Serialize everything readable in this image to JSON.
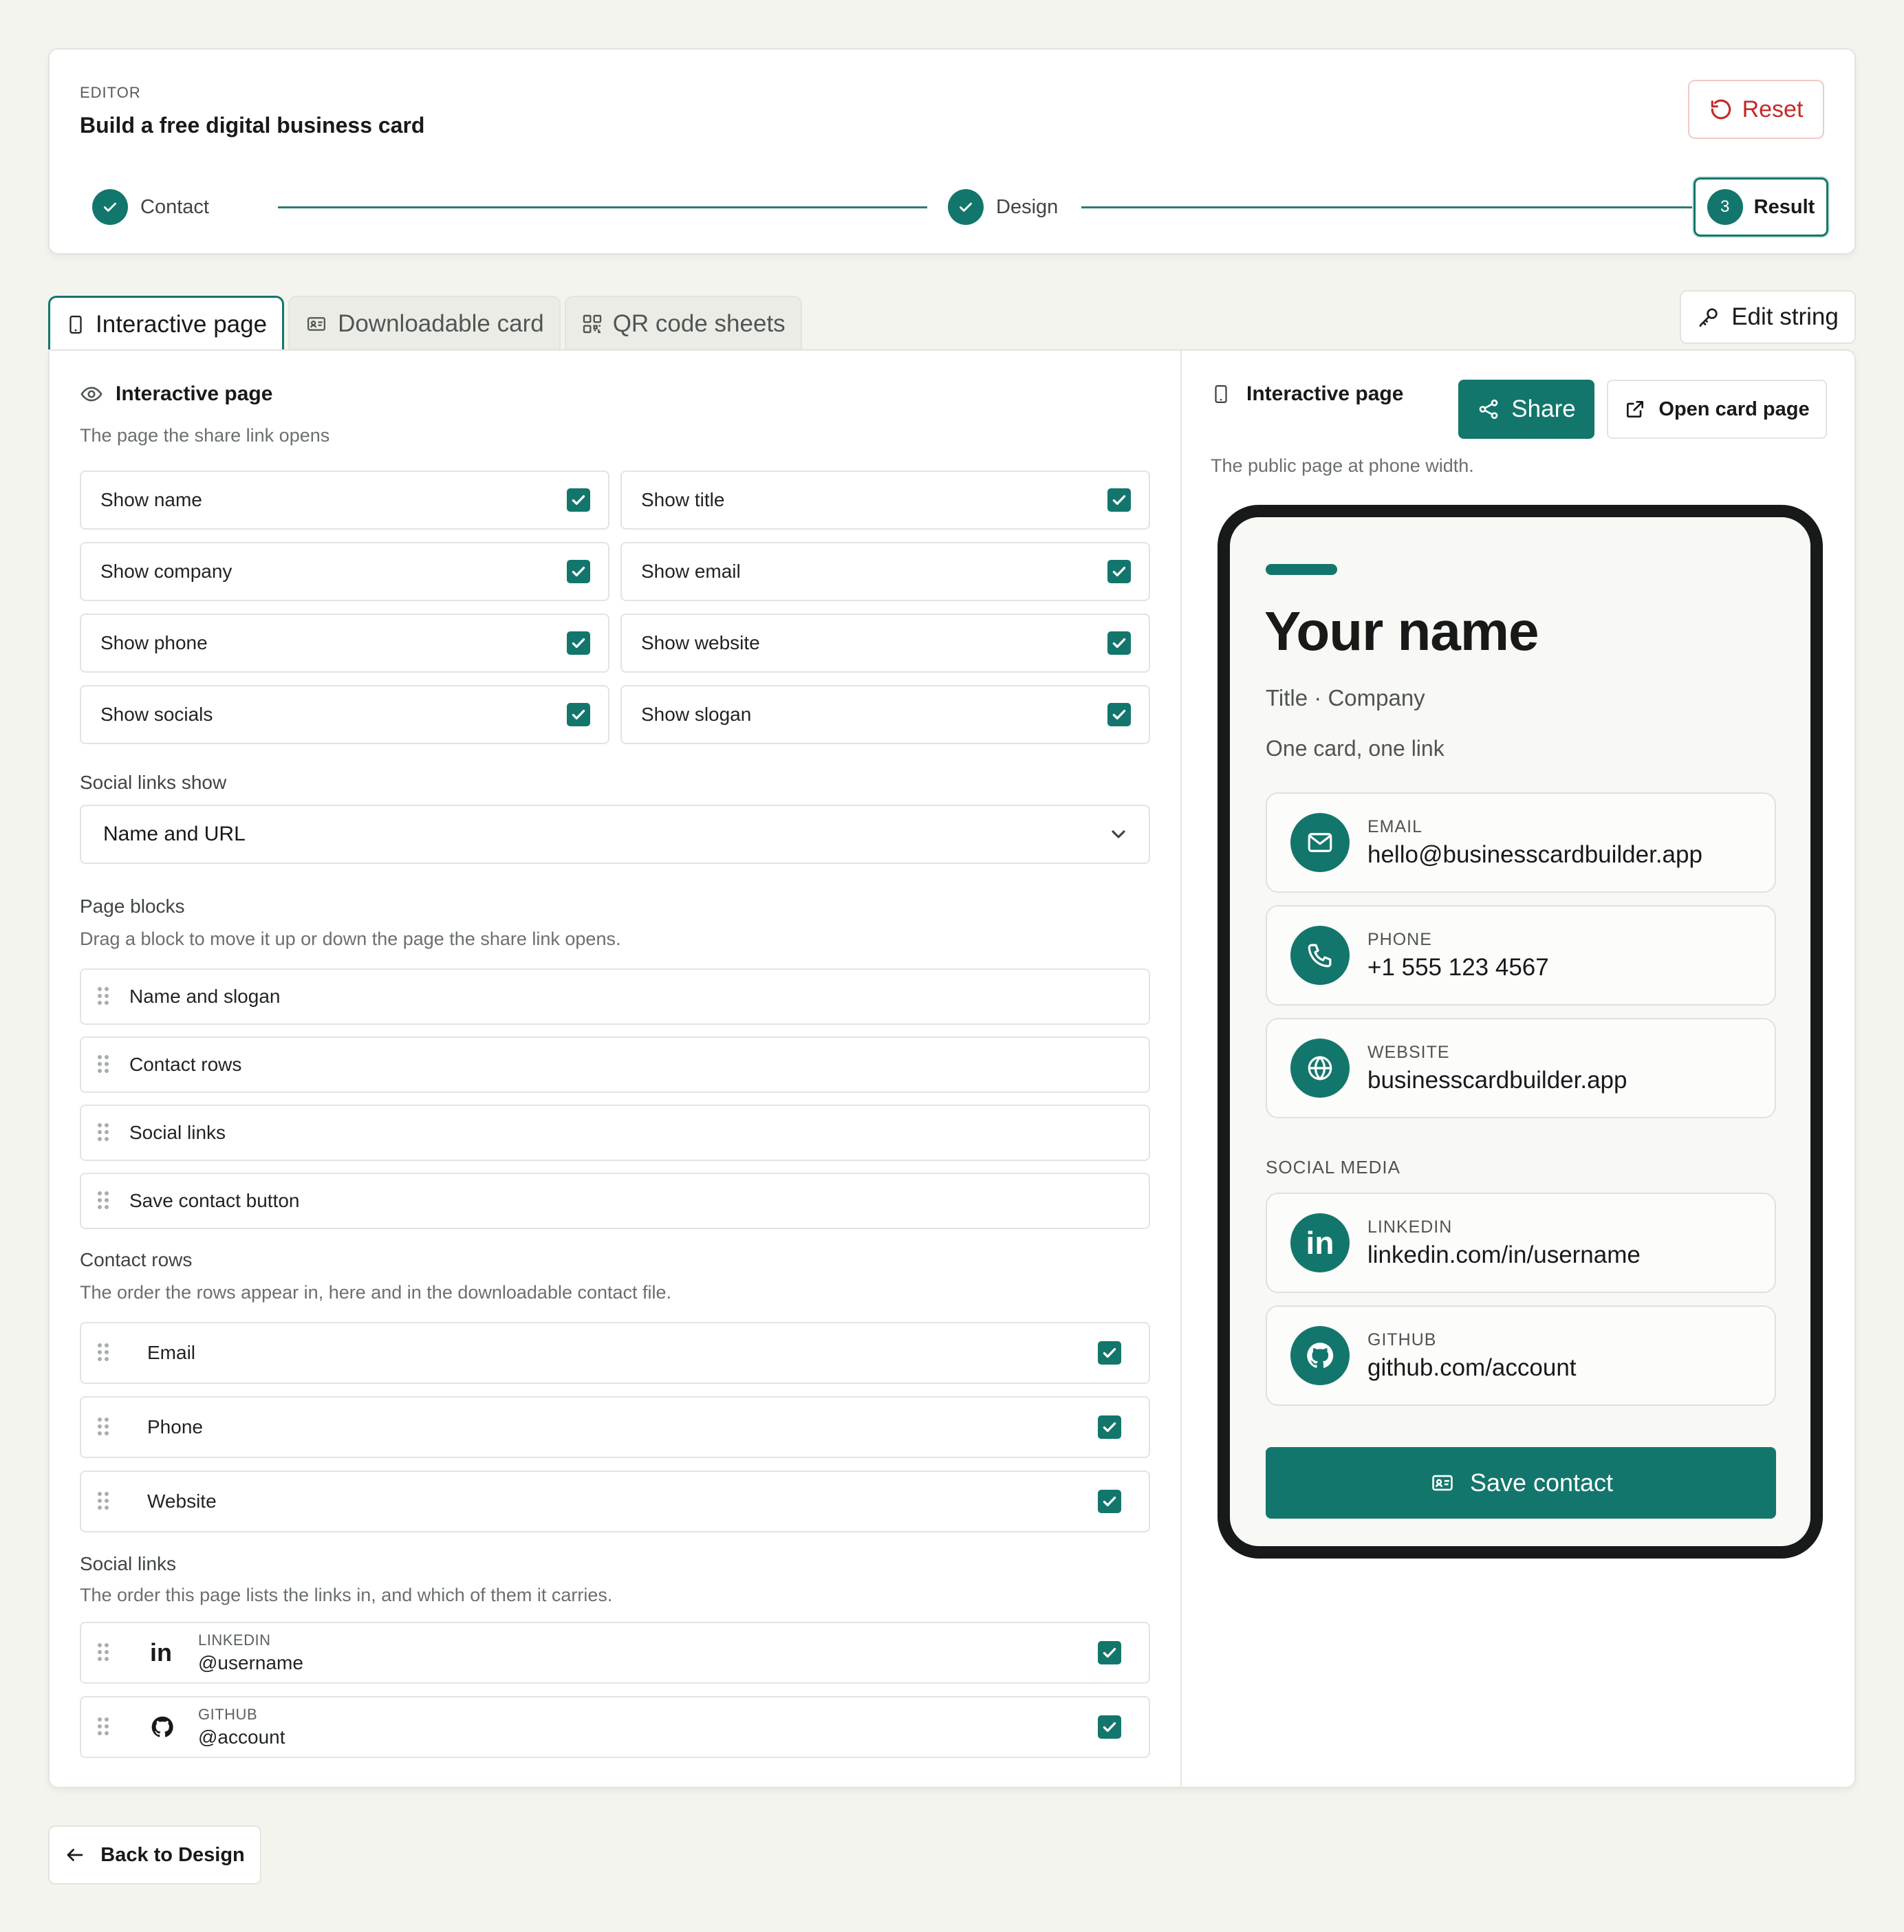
{
  "header": {
    "eyebrow": "EDITOR",
    "title": "Build a free digital business card",
    "reset_label": "Reset"
  },
  "stepper": {
    "steps": [
      {
        "label": "Contact",
        "state": "done"
      },
      {
        "label": "Design",
        "state": "done"
      },
      {
        "label": "Result",
        "state": "current",
        "number": "3"
      }
    ]
  },
  "tabs": [
    {
      "label": "Interactive page",
      "icon": "phone-icon",
      "active": true
    },
    {
      "label": "Downloadable card",
      "icon": "id-card-icon",
      "active": false
    },
    {
      "label": "QR code sheets",
      "icon": "qr-code-icon",
      "active": false
    }
  ],
  "edit_string_label": "Edit string",
  "settings": {
    "title": "Interactive page",
    "subtitle": "The page the share link opens",
    "toggles": [
      {
        "label": "Show name",
        "checked": true
      },
      {
        "label": "Show title",
        "checked": true
      },
      {
        "label": "Show company",
        "checked": true
      },
      {
        "label": "Show email",
        "checked": true
      },
      {
        "label": "Show phone",
        "checked": true
      },
      {
        "label": "Show website",
        "checked": true
      },
      {
        "label": "Show socials",
        "checked": true
      },
      {
        "label": "Show slogan",
        "checked": true
      }
    ],
    "social_links_show_label": "Social links show",
    "social_links_show_value": "Name and URL",
    "page_blocks_label": "Page blocks",
    "page_blocks_hint": "Drag a block to move it up or down the page the share link opens.",
    "page_blocks": [
      "Name and slogan",
      "Contact rows",
      "Social links",
      "Save contact button"
    ],
    "contact_rows_label": "Contact rows",
    "contact_rows_hint": "The order the rows appear in, here and in the downloadable contact file.",
    "contact_rows": [
      {
        "label": "Email",
        "checked": true
      },
      {
        "label": "Phone",
        "checked": true
      },
      {
        "label": "Website",
        "checked": true
      }
    ],
    "social_links_label": "Social links",
    "social_links_hint": "The order this page lists the links in, and which of them it carries.",
    "social_links": [
      {
        "network": "LINKEDIN",
        "handle": "@username",
        "checked": true
      },
      {
        "network": "GITHUB",
        "handle": "@account",
        "checked": true
      }
    ]
  },
  "preview": {
    "title": "Interactive page",
    "share_label": "Share",
    "open_label": "Open card page",
    "caption": "The public page at phone width.",
    "card": {
      "name": "Your name",
      "subtitle": "Title · Company",
      "slogan": "One card, one link",
      "contacts": [
        {
          "key": "EMAIL",
          "value": "hello@businesscardbuilder.app",
          "icon": "mail-icon"
        },
        {
          "key": "PHONE",
          "value": "+1 555 123 4567",
          "icon": "phone-icon"
        },
        {
          "key": "WEBSITE",
          "value": "businesscardbuilder.app",
          "icon": "globe-icon"
        }
      ],
      "social_title": "SOCIAL MEDIA",
      "socials": [
        {
          "key": "LINKEDIN",
          "value": "linkedin.com/in/username",
          "icon": "linkedin-icon"
        },
        {
          "key": "GITHUB",
          "value": "github.com/account",
          "icon": "github-icon"
        }
      ],
      "save_label": "Save contact"
    }
  },
  "back_label": "Back to Design",
  "colors": {
    "accent": "#13766c",
    "danger": "#c62828",
    "background": "#f4f4ef"
  }
}
